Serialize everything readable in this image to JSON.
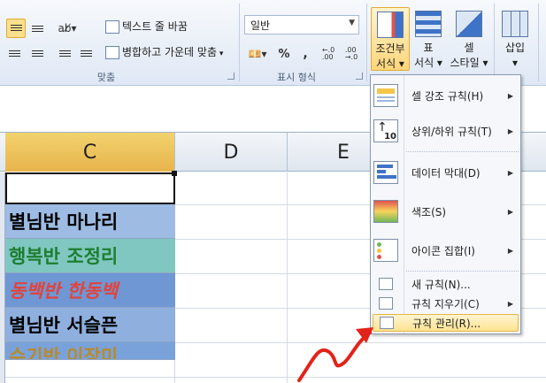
{
  "ribbon": {
    "wrap_text": "텍스트 줄 바꿈",
    "merge_center": "병합하고 가운데 맞춤",
    "alignment_group": "맞춤",
    "number_format_value": "일반",
    "percent": "%",
    "comma": ",",
    "inc_decimal": "←.0\n.00",
    "dec_decimal": ".00\n→.0",
    "number_group": "표시 형식",
    "conditional_format": {
      "line1": "조건부",
      "line2": "서식 ▾"
    },
    "format_table": {
      "line1": "표",
      "line2": "서식 ▾"
    },
    "cell_styles": {
      "line1": "셀",
      "line2": "스타일 ▾"
    },
    "insert": {
      "line1": "삽입",
      "line2": "▾"
    }
  },
  "sheet": {
    "columns": [
      "C",
      "D",
      "E"
    ],
    "cells": [
      {
        "text": "별님반 마나리",
        "color": "#000000",
        "bg": "#9dbbe3"
      },
      {
        "text": "행복반 조정리",
        "color": "#1e7d2f",
        "bg": "#7fc7c0"
      },
      {
        "text": "동백반 한동백",
        "color": "#e0443e",
        "bg": "#6f97d4"
      },
      {
        "text": "별님반 서슬픈",
        "color": "#000000",
        "bg": "#8fb0df"
      },
      {
        "text": "수기반 이장미",
        "color": "#b88a2c",
        "bg": "#7aa2da"
      }
    ]
  },
  "menu": {
    "items": [
      {
        "label": "셀 강조 규칙(H)",
        "icon": "highlight-cells-icon"
      },
      {
        "label": "상위/하위 규칙(T)",
        "icon": "top-bottom-icon"
      },
      {
        "label": "데이터 막대(D)",
        "icon": "data-bar-icon"
      },
      {
        "label": "색조(S)",
        "icon": "color-scale-icon"
      },
      {
        "label": "아이콘 집합(I)",
        "icon": "icon-set-icon"
      }
    ],
    "new_rule": "새 규칙(N)...",
    "clear_rules": "규칙 지우기(C)",
    "manage_rules": "규칙 관리(R)..."
  },
  "annotation": {
    "color": "#e2231a"
  }
}
